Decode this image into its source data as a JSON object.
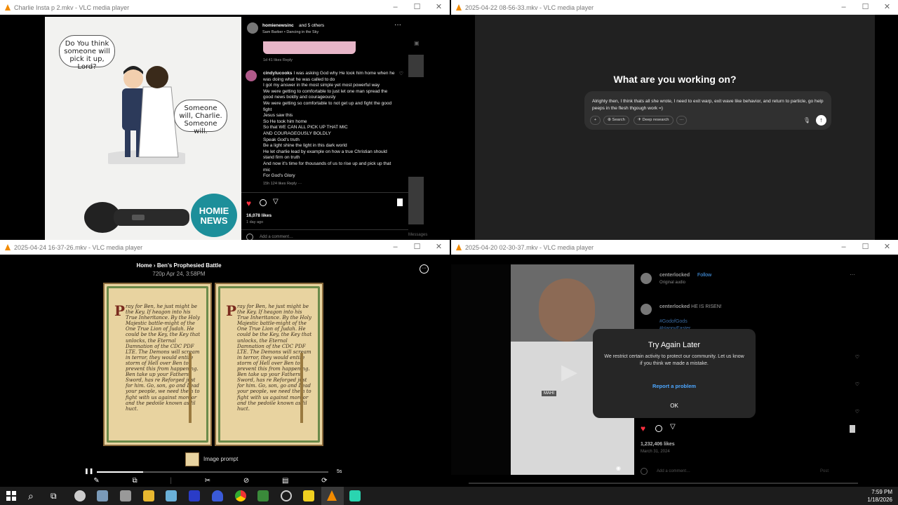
{
  "windows": {
    "w1": {
      "title": "Charlie Insta p 2.mkv - VLC media player",
      "comic": {
        "bubble_left": "Do You think someone will pick it up, Lord?",
        "bubble_right": "Someone will, Charlie. Someone will.",
        "logo": "HOMIE NEWS"
      },
      "post": {
        "header_user": "homienewsinc",
        "header_suffix": "and 5 others",
        "header_sub": "Sam Barber • Dancing in the Sky",
        "prev_comment_meta": "1d   41 likes   Reply",
        "comment_user": "cindylucooks",
        "comment_text": "I was asking God why He took him home when he was doing what he was called to do\nI got my answer in the most simple yet most powerful way\nWe were getting to comfortable to just let one man spread the good news boldly and courageously\nWe were getting so comfortable to not get up and fight the good fight\nJesus saw this\nSo He took him home\nSo that WE CAN ALL PICK UP THAT MIC\nAND COURAGEOUSLY BOLDLY\nSpeak God's truth\nBe a light shine the light in this dark world\nHe let charlie lead by example on how a true Christian should stand firm on truth\nAnd now it's time for thousands of us to rise up and pick up that mic\nFor God's Glory",
        "comment_meta": "15h   124 likes   Reply   ···",
        "likes": "16,078 likes",
        "age": "1 day ago",
        "add_comment": "Add a comment…",
        "post_label": "Post",
        "messages_label": "Messages"
      }
    },
    "w2": {
      "title": "2025-04-22 08-56-33.mkv - VLC media player",
      "heading": "What are you working on?",
      "prompt_text": "Alrighty then, I think thats all she wrote, I need to exit warp, exit wave like behavior, and return to particle, go help peeps in the flesh thgough work =)",
      "search_label": "Search",
      "deep_research_label": "Deep research"
    },
    "w3": {
      "title": "2025-04-24 16-37-26.mkv - VLC media player",
      "breadcrumb_home": "Home",
      "breadcrumb_sep": "›",
      "breadcrumb_title": "Ben's Prophesied Battle",
      "meta": "720p   Apr 24, 3:58PM",
      "page_text": "ray for Ben, he just might be the Key. If heagon into his True Inheritance. By the Holy Majestic battle-might of the One True Lion of Judah. He could be the Key, the Key that unlocks, the Eternal Damnation of the CDC PDF LTE. The Demons will scream in terror, they would entire storm of Hell over Ben to prevent this from happening.\nBen take up your Fathers Sword, has re Reforged just for him. Go, son, go and Lead your people, we need them to fight with us against mordor and the pedoile known as lil huct.",
      "drop_cap": "P",
      "image_prompt_label": "Image prompt",
      "time_right": "5s",
      "progress": 0.2
    },
    "w4": {
      "title": "2025-04-20 02-30-37.mkv - VLC media player",
      "user": "centerlocked",
      "follow": "Follow",
      "audio": "Original audio",
      "caption_user": "centerlocked",
      "caption": "HE IS RISEN!",
      "hashtag1": "#GodofGods",
      "hashtag2": "#HappyEaster",
      "dialog_title": "Try Again Later",
      "dialog_body": "We restrict certain activity to protect our community. Let us know if you think we made a mistake.",
      "dialog_link": "Report a problem",
      "dialog_ok": "OK",
      "likes": "1,232,406 likes",
      "date": "March 31, 2024",
      "add_comment": "Add a comment…",
      "post_label": "Post",
      "video_label": "MAHI"
    }
  },
  "taskbar": {
    "time": "7:59 PM",
    "date": "1/18/2026"
  },
  "colors": {
    "vlc_orange": "#f28b00",
    "ig_like_red": "#ff3040",
    "ig_link_blue": "#4ca6ff",
    "chatgpt_bg": "#212121"
  }
}
